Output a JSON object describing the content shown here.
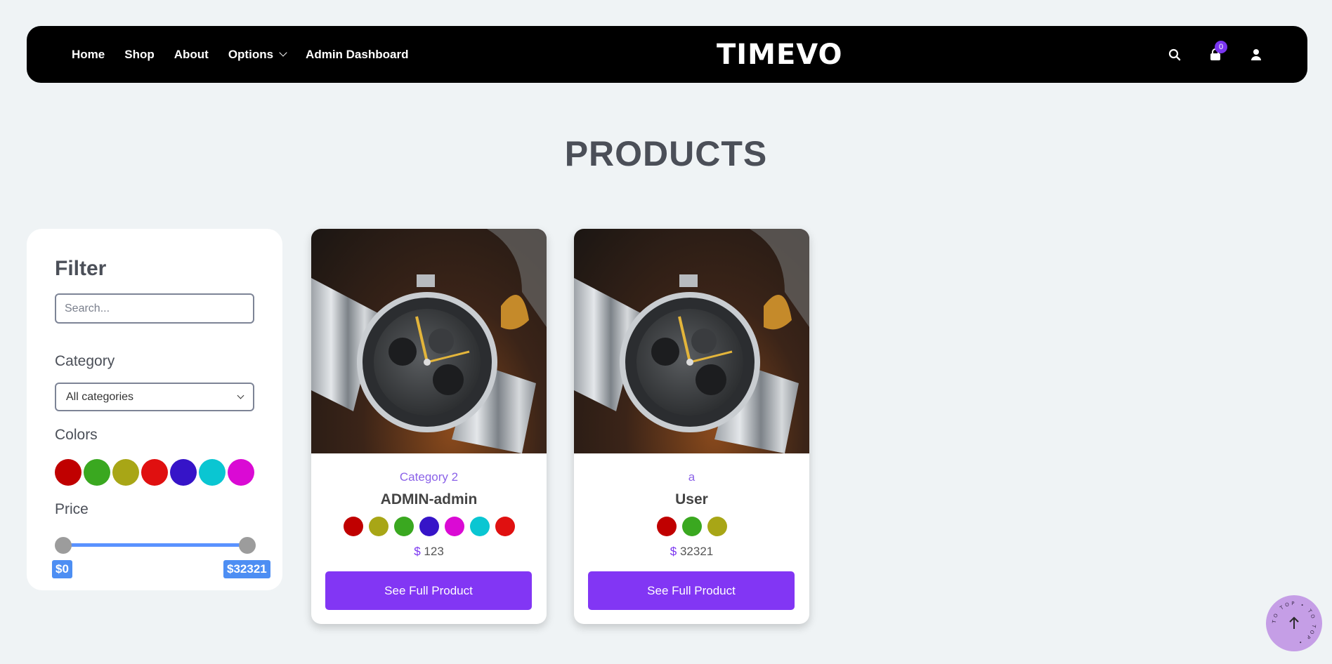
{
  "nav": {
    "links": [
      "Home",
      "Shop",
      "About",
      "Options",
      "Admin Dashboard"
    ],
    "logo": "TIMEVO",
    "cart_count": "0"
  },
  "page_title": "PRODUCTS",
  "filter": {
    "title": "Filter",
    "search_placeholder": "Search...",
    "category_label": "Category",
    "category_selected": "All categories",
    "colors_label": "Colors",
    "colors": [
      "#c00000",
      "#3aa820",
      "#a8a616",
      "#e01010",
      "#3614c8",
      "#0ac6d2",
      "#da0ad4"
    ],
    "price_label": "Price",
    "price_min": "$0",
    "price_max": "$32321"
  },
  "products": [
    {
      "category": "Category 2",
      "name": "ADMIN-admin",
      "colors": [
        "#c00000",
        "#a8a616",
        "#3aa820",
        "#3614c8",
        "#da0ad4",
        "#0ac6d2",
        "#e01010"
      ],
      "currency": "$",
      "price": "123",
      "button": "See Full Product"
    },
    {
      "category": "a",
      "name": "User",
      "colors": [
        "#c00000",
        "#3aa820",
        "#a8a616"
      ],
      "currency": "$",
      "price": "32321",
      "button": "See Full Product"
    }
  ],
  "scroll_top_text": "TO TOP • TO TOP •"
}
